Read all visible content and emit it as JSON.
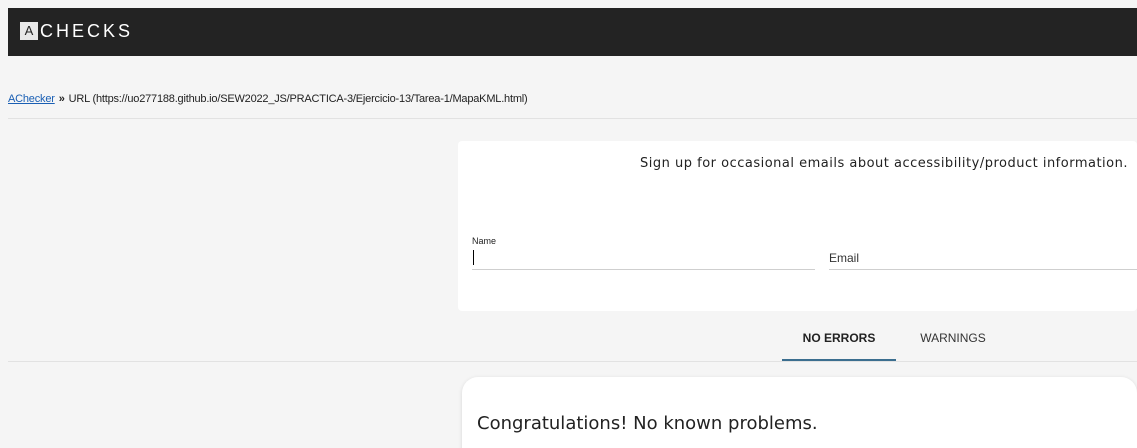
{
  "header": {
    "logo_letter": "A",
    "brand": "CHECKS"
  },
  "breadcrumb": {
    "link": "AChecker",
    "separator": "»",
    "current": "URL (https://uo277188.github.io/SEW2022_JS/PRACTICA-3/Ejercicio-13/Tarea-1/MapaKML.html)"
  },
  "signup": {
    "message": "Sign up for occasional emails about accessibility/product information.",
    "name_label": "Name",
    "name_value": "",
    "email_placeholder": "Email"
  },
  "tabs": [
    {
      "label": "NO ERRORS",
      "active": true
    },
    {
      "label": "WARNINGS",
      "active": false
    }
  ],
  "result": {
    "message": "Congratulations! No known problems."
  },
  "colors": {
    "topbar": "#232323",
    "link": "#1a5fb4",
    "active_tab_underline": "#3b6e8f"
  }
}
